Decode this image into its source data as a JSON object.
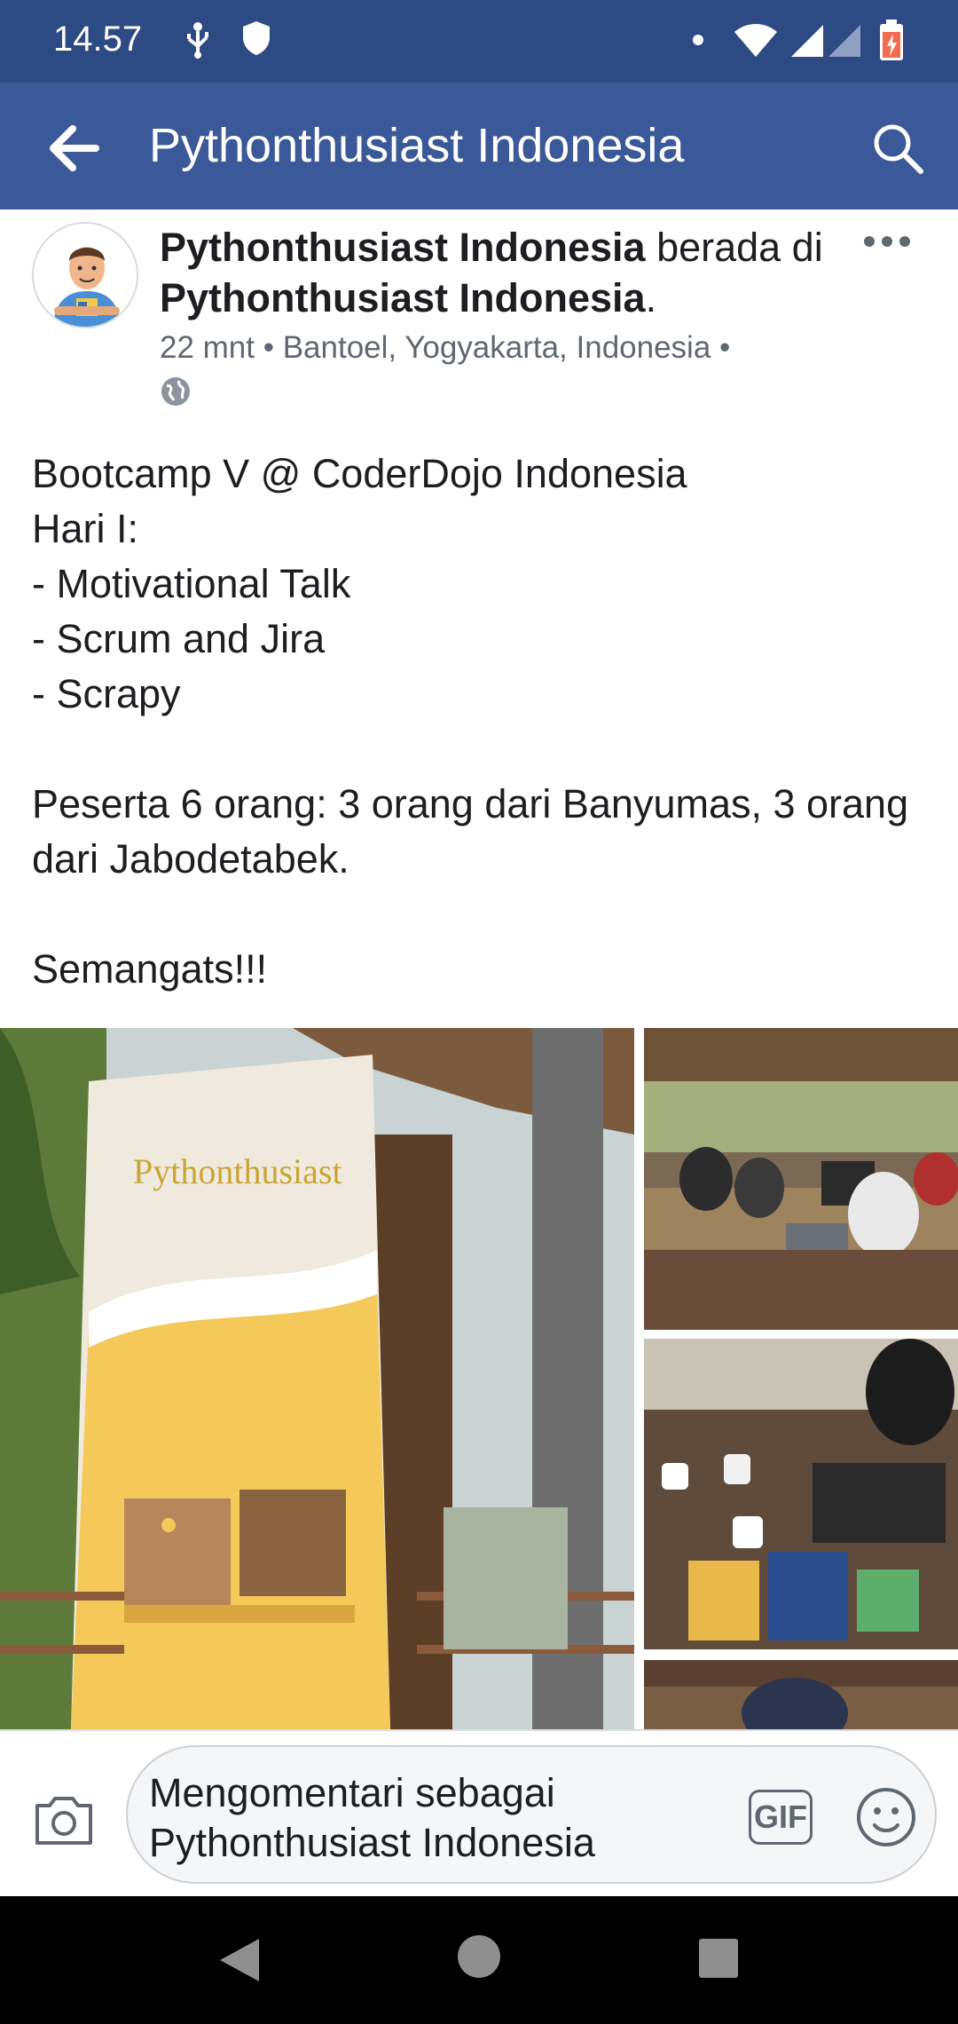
{
  "status_bar": {
    "time": "14.57",
    "icons": [
      "usb-debug-icon",
      "shield-icon",
      "dot-icon",
      "wifi-icon",
      "signal-icon",
      "battery-charging-icon"
    ]
  },
  "app_bar": {
    "title": "Pythonthusiast Indonesia",
    "back_icon": "arrow-left-icon",
    "search_icon": "search-icon"
  },
  "post": {
    "author": "Pythonthusiast Indonesia",
    "connector": " berada di ",
    "location_page": "Pythonthusiast Indonesia",
    "trailing": ".",
    "meta": "22 mnt • Bantoel, Yogyakarta, Indonesia •",
    "privacy_icon": "globe-icon",
    "more_icon": "more-horizontal-icon",
    "text": "Bootcamp V @ CoderDojo Indonesia\nHari I:\n- Motivational Talk\n- Scrum and Jira\n- Scrapy\n\nPeserta 6 orang: 3 orang dari Banyumas, 3 orang dari Jabodetabek.\n\nSemangats!!!",
    "photos": [
      {
        "name": "banner-photo",
        "banner_text": "Pythonthusiast"
      },
      {
        "name": "workshop-photo-1"
      },
      {
        "name": "workshop-photo-2"
      },
      {
        "name": "workshop-photo-3"
      }
    ]
  },
  "comment_bar": {
    "placeholder": "Mengomentari sebagai Pythonthusiast Indonesia",
    "camera_icon": "camera-icon",
    "gif_label": "GIF",
    "emoji_icon": "smiley-icon"
  },
  "nav_bar": {
    "icons": [
      "nav-back-icon",
      "nav-home-icon",
      "nav-recent-icon"
    ]
  },
  "colors": {
    "status_bar": "#2e4a84",
    "app_bar": "#3b5998",
    "text": "#1c1e21",
    "meta": "#606770"
  }
}
